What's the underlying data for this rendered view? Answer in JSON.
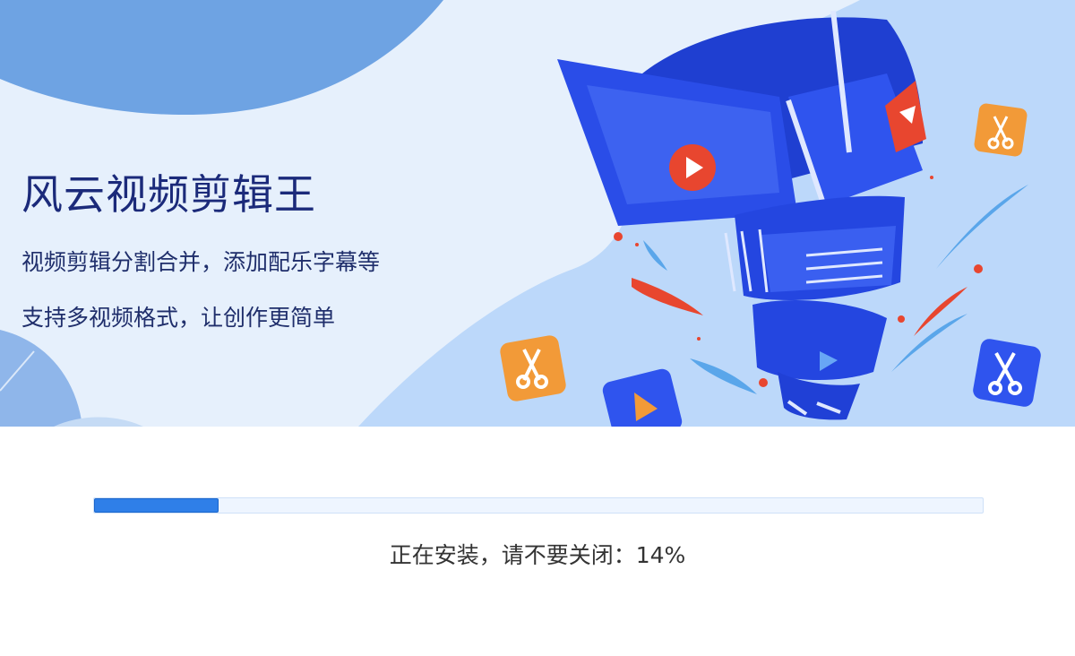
{
  "app": {
    "title": "风云视频剪辑王",
    "tagline1": "视频剪辑分割合并，添加配乐字幕等",
    "tagline2": "支持多视频格式，让创作更简单"
  },
  "install": {
    "status_label": "正在安装，请不要关闭：",
    "percent_text": "14%",
    "progress": 0.14
  },
  "colors": {
    "accent": "#2f7fe8",
    "hero_bg": "#e6f0fc",
    "title": "#1b2a7a",
    "film_blue": "#2a4de8",
    "red": "#e8462f",
    "orange": "#f29a38"
  }
}
